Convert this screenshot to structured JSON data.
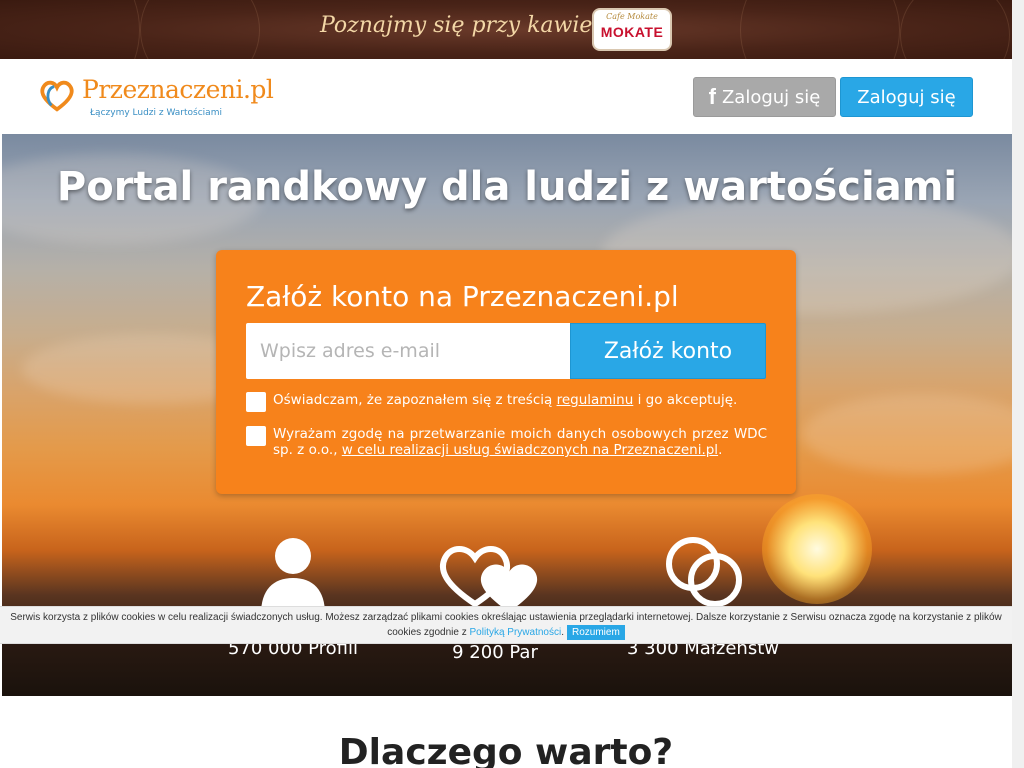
{
  "promo": {
    "text": "Poznajmy się przy kawie",
    "logo_small": "Cafe Mokate",
    "logo_brand": "MOKATE"
  },
  "header": {
    "logo_text": "Przeznaczeni.pl",
    "logo_tagline": "Łączymy Ludzi z Wartościami",
    "fb_login_label": "Zaloguj się",
    "login_label": "Zaloguj się"
  },
  "hero": {
    "title": "Portal randkowy dla ludzi z wartościami",
    "signup": {
      "title": "Załóż konto na Przeznaczeni.pl",
      "email_placeholder": "Wpisz adres e-mail",
      "submit_label": "Załóż konto",
      "consent1_pre": "Oświadczam, że zapoznałem się z treścią ",
      "consent1_link": "regulaminu",
      "consent1_post": " i go akceptuję.",
      "consent2_pre": "Wyrażam zgodę na przetwarzanie moich danych osobowych przez WDC sp. z o.o., ",
      "consent2_link": "w celu realizacji usług świadczonych na Przeznaczeni.pl",
      "consent2_post": "."
    },
    "stats": [
      {
        "icon": "person-icon",
        "label": "570 000 Profili"
      },
      {
        "icon": "hearts-icon",
        "label": "9 200 Par"
      },
      {
        "icon": "rings-icon",
        "label": "3 300 Małżenstw"
      }
    ]
  },
  "cookie": {
    "text_pre": "Serwis korzysta z plików cookies w celu realizacji świadczonych usług. Możesz zarządzać plikami cookies określając ustawienia przeglądarki internetowej. Dalsze korzystanie z Serwisu oznacza zgodę na korzystanie z plików cookies zgodnie z ",
    "link": "Polityką Prywatności",
    "text_post": ".",
    "button": "Rozumiem"
  },
  "section": {
    "why_title": "Dlaczego warto?"
  },
  "colors": {
    "orange": "#f7821b",
    "blue": "#29a7e6",
    "gray_button": "#a9a9a9",
    "banner_brown": "#4a2418"
  }
}
